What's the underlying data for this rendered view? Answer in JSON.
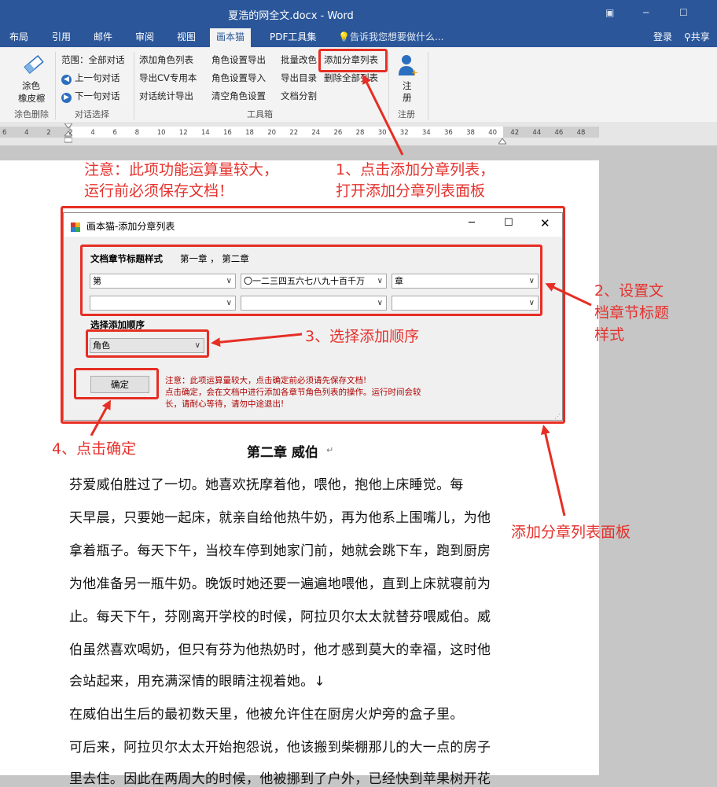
{
  "window": {
    "title": "夏浩的网全文.docx - Word",
    "restore_icon": "ribbon-display-icon",
    "minimize_icon": "minimize-icon",
    "maximize_icon": "maximize-icon"
  },
  "tabs": [
    "布局",
    "引用",
    "邮件",
    "审阅",
    "视图",
    "画本猫",
    "PDF工具集"
  ],
  "active_tab": "画本猫",
  "tell_me": "告诉我您想要做什么...",
  "account": {
    "login": "登录",
    "share": "共享"
  },
  "ribbon": {
    "eraser": {
      "label1": "涂色",
      "label2": "橡皮檫",
      "group": "涂色删除"
    },
    "dialog_group": {
      "scope": "范围：全部对话",
      "prev": "上一句对话",
      "next": "下一句对话",
      "group": "对话选择"
    },
    "toolbox": {
      "col1": [
        "添加角色列表",
        "导出CV专用本",
        "对话统计导出"
      ],
      "col2": [
        "角色设置导出",
        "角色设置导入",
        "清空角色设置"
      ],
      "col3": [
        "批量改色",
        "导出目录",
        "文档分割"
      ],
      "col4": [
        "添加分章列表",
        "删除全部列表"
      ],
      "group": "工具箱"
    },
    "register": {
      "label1": "注",
      "label2": "册",
      "group": "注册"
    }
  },
  "ruler": {
    "ticks": [
      "6",
      "4",
      "2",
      "2",
      "4",
      "6",
      "8",
      "10",
      "12",
      "14",
      "16",
      "18",
      "20",
      "22",
      "24",
      "26",
      "28",
      "30",
      "32",
      "34",
      "36",
      "38",
      "40",
      "42",
      "44",
      "46",
      "48"
    ]
  },
  "annotations": {
    "warning_line1": "注意：此项功能运算量较大，",
    "warning_line2": "运行前必须保存文档！",
    "step1_line1": "1、点击添加分章列表，",
    "step1_line2": "打开添加分章列表面板",
    "step2_line1": "2、设置文",
    "step2_line2": "档章节标题",
    "step2_line3": "样式",
    "step3": "3、选择添加顺序",
    "step4": "4、点击确定",
    "panel_label": "添加分章列表面板"
  },
  "dialog": {
    "title": "画本猫-添加分章列表",
    "style_label": "文档章节标题样式",
    "style_example": "第一章 ， 第二章",
    "combos_row1": [
      "第",
      "〇一二三四五六七八九十百千万",
      "章"
    ],
    "combos_row2": [
      "",
      "",
      ""
    ],
    "order_label": "选择添加顺序",
    "order_value": "角色",
    "ok_button": "确定",
    "notice_line1": "注意：此项运算量较大，点击确定前必须请先保存文档!",
    "notice_line2": "点击确定，会在文档中进行添加各章节角色列表的操作。运行时间会较",
    "notice_line3": "长，请耐心等待，请勿中途退出!"
  },
  "document": {
    "heading": "第二章  威伯",
    "lines": [
      "    芬爱威伯胜过了一切。她喜欢抚摩着他，喂他，抱他上床睡觉。每",
      "天早晨，只要她一起床，就亲自给他热牛奶，再为他系上围嘴儿，为他",
      "拿着瓶子。每天下午，当校车停到她家门前，她就会跳下车，跑到厨房",
      "为他准备另一瓶牛奶。晚饭时她还要一遍遍地喂他，直到上床就寝前为",
      "止。每天下午，芬刚离开学校的时候，阿拉贝尔太太就替芬喂威伯。威",
      "伯虽然喜欢喝奶，但只有芬为他热奶时，他才感到莫大的幸福，这时他",
      "会站起来，用充满深情的眼睛注视着她。↓",
      "    在威伯出生后的最初数天里，他被允许住在厨房火炉旁的盒子里。",
      "可后来，阿拉贝尔太太开始抱怨说，他该搬到柴棚那儿的大一点的房子",
      "里去住。因此在两周大的时候，他被挪到了户外，已经快到苹果树开花"
    ]
  }
}
